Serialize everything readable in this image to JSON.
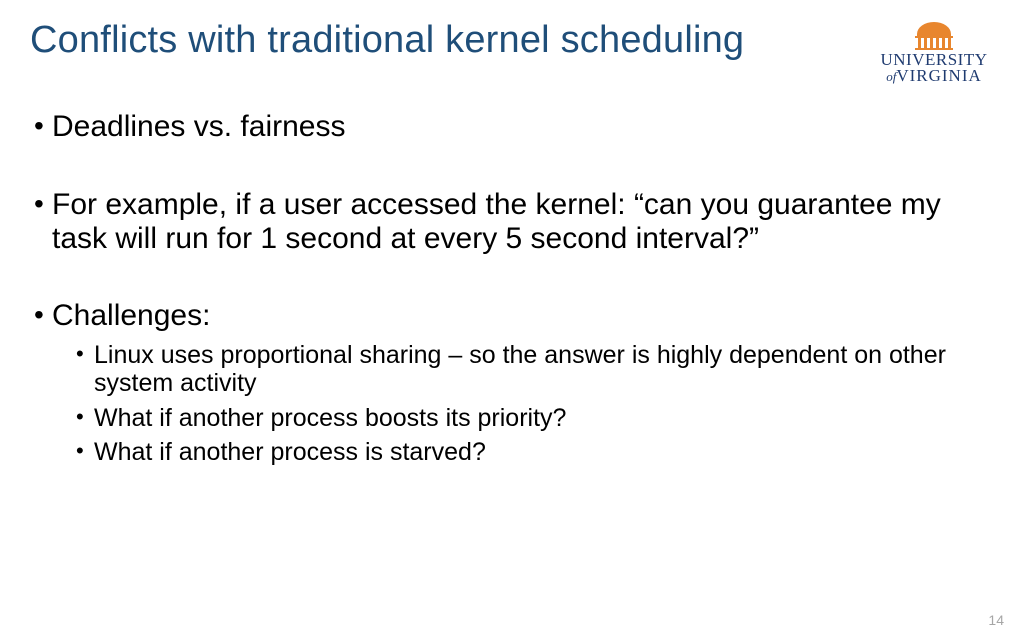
{
  "title": "Conflicts with traditional kernel scheduling",
  "logo": {
    "alt": "University of Virginia",
    "line1": "UNIVERSITY",
    "of": "of",
    "line2": "VIRGINIA"
  },
  "bullets": {
    "b1": "Deadlines vs. fairness",
    "b2": "For example, if a user accessed the kernel: “can you guarantee my task will run for 1 second at every 5 second interval?”",
    "b3": "Challenges:",
    "sub": {
      "s1": "Linux uses proportional sharing – so the answer is highly dependent on other system activity",
      "s2": "What if another process boosts its priority?",
      "s3": "What if another process is starved?"
    }
  },
  "page_number": "14"
}
